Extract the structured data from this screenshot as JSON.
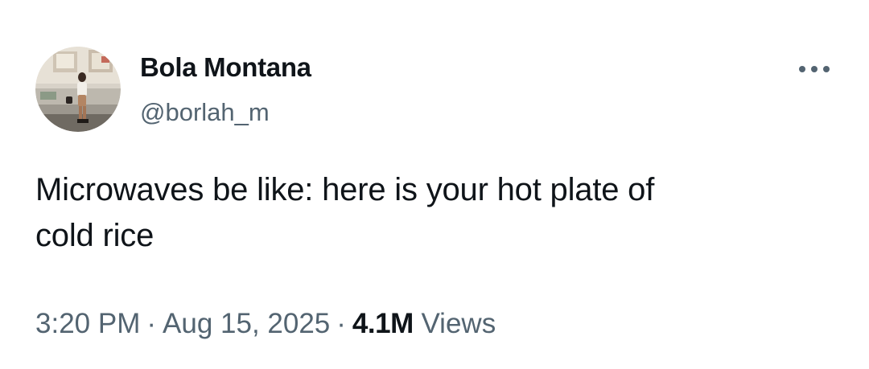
{
  "tweet": {
    "author": {
      "display_name": "Bola Montana",
      "handle": "@borlah_m",
      "avatar_icon": "profile-photo"
    },
    "more_icon": "more-horizontal-icon",
    "text_lines": [
      "Microwaves be like: here is your hot plate of",
      "cold rice"
    ],
    "meta": {
      "time": "3:20 PM",
      "separator": "·",
      "date": "Aug 15, 2025",
      "views_count": "4.1M",
      "views_label": "Views"
    }
  },
  "colors": {
    "text_primary": "#0f1419",
    "text_secondary": "#536471",
    "background": "#ffffff"
  }
}
